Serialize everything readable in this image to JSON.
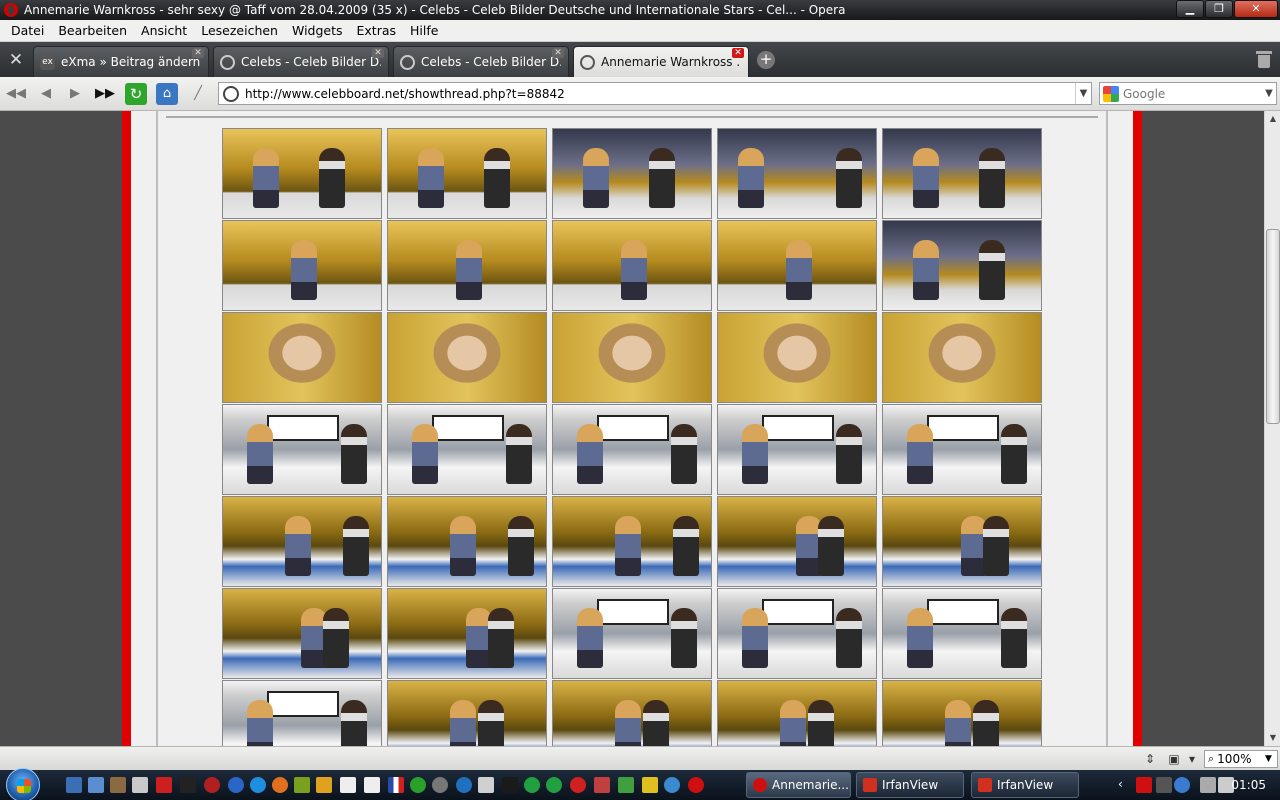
{
  "window": {
    "title": "Annemarie Warnkross - sehr sexy @ Taff vom 28.04.2009 (35 x) - Celebs - Celeb Bilder Deutsche und Internationale Stars - Cel... - Opera"
  },
  "menu": {
    "items": [
      "Datei",
      "Bearbeiten",
      "Ansicht",
      "Lesezeichen",
      "Widgets",
      "Extras",
      "Hilfe"
    ]
  },
  "tabs": [
    {
      "label": "eXma » Beitrag ändern..."
    },
    {
      "label": "Celebs - Celeb Bilder D..."
    },
    {
      "label": "Celebs - Celeb Bilder D..."
    },
    {
      "label": "Annemarie Warnkross ..."
    }
  ],
  "address": {
    "url": "http://www.celebboard.net/showthread.php?t=88842"
  },
  "search": {
    "placeholder": "Google"
  },
  "status": {
    "zoom": "100%"
  },
  "taskbar": {
    "buttons": [
      {
        "label": "Annemarie..."
      },
      {
        "label": "IrfanView"
      },
      {
        "label": "IrfanView"
      }
    ],
    "clock": "01:05"
  },
  "colors": {
    "accent_red": "#e30000",
    "tab_close": "#d01818"
  },
  "icons": {
    "title": "opera-icon",
    "tools": "wrench-icon",
    "rewind": "rewind-icon",
    "back": "back-icon",
    "forward": "forward-icon",
    "fast_forward": "fast-forward-icon",
    "reload": "reload-icon",
    "home": "home-icon",
    "edit": "wand-icon",
    "trash": "trash-icon"
  }
}
